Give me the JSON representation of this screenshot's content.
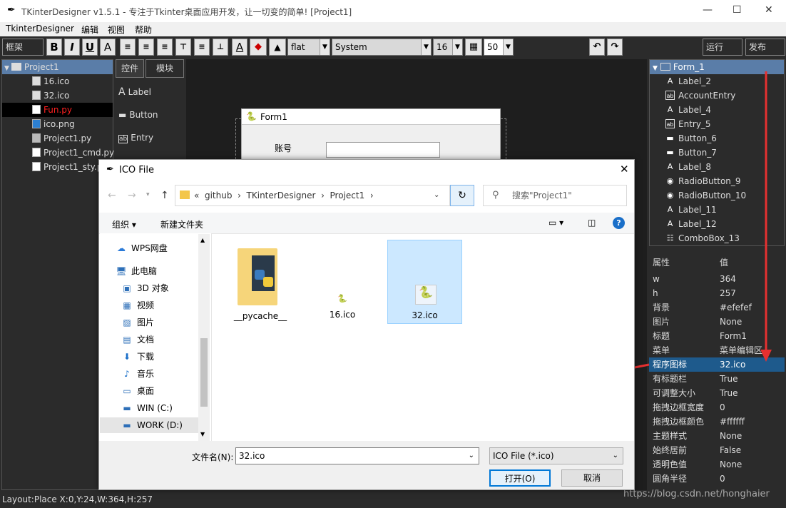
{
  "window": {
    "title": "TKinterDesigner v1.5.1 - 专注于Tkinter桌面应用开发，让一切变的简单!   [Project1]",
    "minimize": "—",
    "maximize": "☐",
    "close": "✕"
  },
  "menu": [
    "TkinterDesigner",
    "编辑",
    "视图",
    "帮助"
  ],
  "toolbar": {
    "frame_label": "框架",
    "bold": "B",
    "italic": "I",
    "underline": "U",
    "font_color": "A",
    "relief": "flat",
    "font_family": "System",
    "font_size": "16",
    "alpha": "50",
    "run": "运行",
    "publish": "发布"
  },
  "project_tree": {
    "root": "Project1",
    "items": [
      "16.ico",
      "32.ico",
      "Fun.py",
      "ico.png",
      "Project1.py",
      "Project1_cmd.py",
      "Project1_sty.p"
    ],
    "selected": "Fun.py",
    "selected_color": "#ff2020"
  },
  "widget_tabs": {
    "tabs": [
      "控件",
      "模块"
    ],
    "items": [
      "Label",
      "Button",
      "Entry"
    ],
    "item_icons": [
      "A",
      "▬",
      "ab"
    ]
  },
  "form": {
    "title": "Form1",
    "account_label": "账号"
  },
  "component_tree": {
    "root": "Form_1",
    "items": [
      {
        "label": "Label_2",
        "icon": "A"
      },
      {
        "label": "AccountEntry",
        "icon": "ab"
      },
      {
        "label": "Label_4",
        "icon": "A"
      },
      {
        "label": "Entry_5",
        "icon": "ab"
      },
      {
        "label": "Button_6",
        "icon": "▬"
      },
      {
        "label": "Button_7",
        "icon": "▬"
      },
      {
        "label": "Label_8",
        "icon": "A"
      },
      {
        "label": "RadioButton_9",
        "icon": "◉"
      },
      {
        "label": "RadioButton_10",
        "icon": "◉"
      },
      {
        "label": "Label_11",
        "icon": "A"
      },
      {
        "label": "Label_12",
        "icon": "A"
      },
      {
        "label": "ComboBox_13",
        "icon": "☷"
      }
    ]
  },
  "properties": {
    "header_key": "属性",
    "header_value": "值",
    "rows": [
      [
        "w",
        "364"
      ],
      [
        "h",
        "257"
      ],
      [
        "背景",
        "#efefef"
      ],
      [
        "图片",
        "None"
      ],
      [
        "标题",
        "Form1"
      ],
      [
        "菜单",
        "菜单编辑区"
      ],
      [
        "程序图标",
        "32.ico"
      ],
      [
        "有标题栏",
        "True"
      ],
      [
        "可调整大小",
        "True"
      ],
      [
        "拖拽边框宽度",
        "0"
      ],
      [
        "拖拽边框颜色",
        "#ffffff"
      ],
      [
        "主题样式",
        "None"
      ],
      [
        "始终居前",
        "False"
      ],
      [
        "透明色值",
        "None"
      ],
      [
        "圆角半径",
        "0"
      ]
    ],
    "selected_row": "程序图标"
  },
  "status": {
    "text": "Layout:Place  X:0,Y:24,W:364,H:257",
    "watermark": "https://blog.csdn.net/honghaier"
  },
  "dialog": {
    "title": "ICO File",
    "path": [
      "«",
      "github",
      "TKinterDesigner",
      "Project1"
    ],
    "search_placeholder": "搜索\"Project1\"",
    "organize": "组织 ▾",
    "new_folder": "新建文件夹",
    "nav": [
      {
        "label": "WPS网盘",
        "icon": "☁"
      },
      {
        "label": "此电脑",
        "icon": "🖥"
      },
      {
        "label": "3D 对象",
        "icon": "▣"
      },
      {
        "label": "视频",
        "icon": "▦"
      },
      {
        "label": "图片",
        "icon": "▨"
      },
      {
        "label": "文档",
        "icon": "▤"
      },
      {
        "label": "下载",
        "icon": "⬇"
      },
      {
        "label": "音乐",
        "icon": "♪"
      },
      {
        "label": "桌面",
        "icon": "▭"
      },
      {
        "label": "WIN (C:)",
        "icon": "▬"
      },
      {
        "label": "WORK (D:)",
        "icon": "▬"
      }
    ],
    "files": [
      "__pycache__",
      "16.ico",
      "32.ico"
    ],
    "selected_file": "32.ico",
    "filename_label": "文件名(N):",
    "filename_value": "32.ico",
    "filter": "ICO File (*.ico)",
    "open_button": "打开(O)",
    "cancel_button": "取消"
  },
  "colors": {
    "accent_selected": "#cce8ff",
    "tree_highlight": "#5a7da8",
    "arrow": "#e63030"
  }
}
